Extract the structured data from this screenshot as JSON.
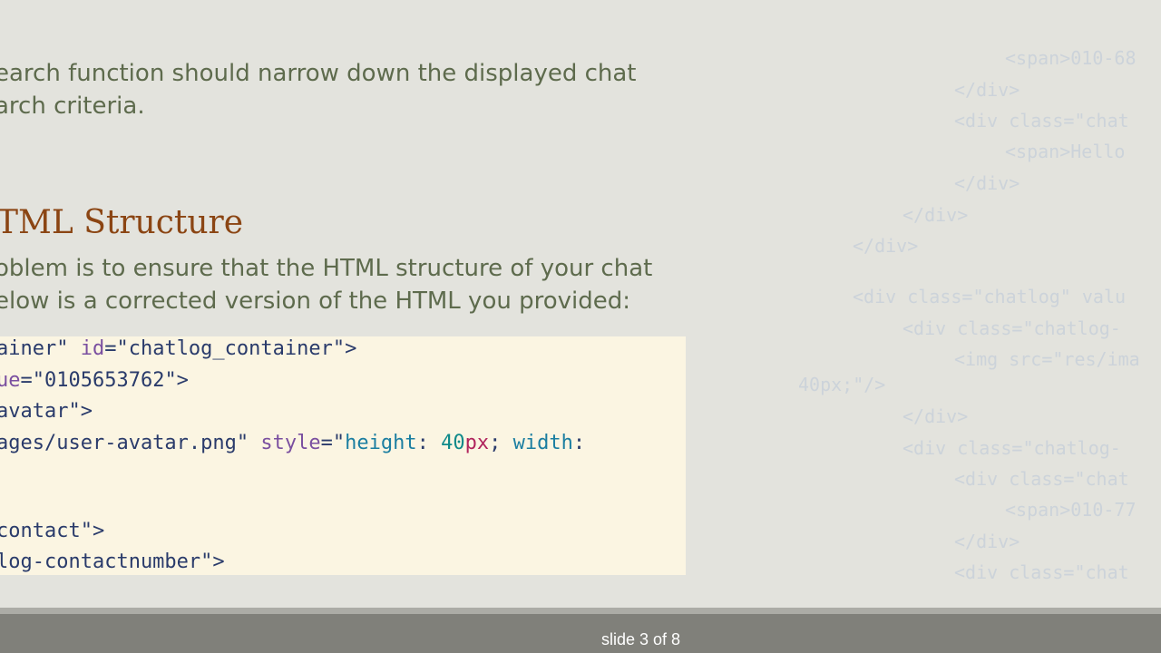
{
  "background_code": [
    "<span>010-68",
    "</div>",
    "<div class=\"chat",
    "<span>Hello",
    "</div>",
    "</div>",
    "</div>",
    "<div class=\"chatlog\" valu",
    "<div class=\"chatlog-",
    "<img src=\"res/ima",
    "40px;\"/>",
    "</div>",
    "<div class=\"chatlog-",
    "<div class=\"chat",
    "<span>010-77",
    "</div>",
    "<div class=\"chat"
  ],
  "paragraph_1": {
    "line_1": "earch function should narrow down the displayed chat",
    "line_2": "arch criteria."
  },
  "section_heading": "TML Structure",
  "paragraph_2": {
    "line_1": "oblem is to ensure that the HTML structure of your chat",
    "line_2": "elow is a corrected version of the HTML you provided:"
  },
  "code_lines": [
    [
      {
        "t": "ainer\" ",
        "c": "tok-str"
      },
      {
        "t": "id",
        "c": "tok-attr"
      },
      {
        "t": "=\"chatlog_container\">",
        "c": "tok-str"
      }
    ],
    [
      {
        "t": "ue",
        "c": "tok-attr"
      },
      {
        "t": "=\"0105653762\">",
        "c": "tok-str"
      }
    ],
    [
      {
        "t": "avatar\">",
        "c": "tok-str"
      }
    ],
    [
      {
        "t": "ages/user-avatar.png\" ",
        "c": "tok-str"
      },
      {
        "t": "style",
        "c": "tok-attr"
      },
      {
        "t": "=\"",
        "c": "tok-str"
      },
      {
        "t": "height",
        "c": "tok-prop"
      },
      {
        "t": ": ",
        "c": "tok-str"
      },
      {
        "t": "40",
        "c": "tok-num"
      },
      {
        "t": "px",
        "c": "tok-unit"
      },
      {
        "t": "; ",
        "c": "tok-str"
      },
      {
        "t": "width",
        "c": "tok-prop"
      },
      {
        "t": ":",
        "c": "tok-str"
      }
    ],
    [],
    [
      {
        "t": "contact\">",
        "c": "tok-str"
      }
    ],
    [
      {
        "t": "log-contactnumber\">",
        "c": "tok-str"
      }
    ]
  ],
  "footer": {
    "slide_counter": "slide 3 of 8"
  }
}
